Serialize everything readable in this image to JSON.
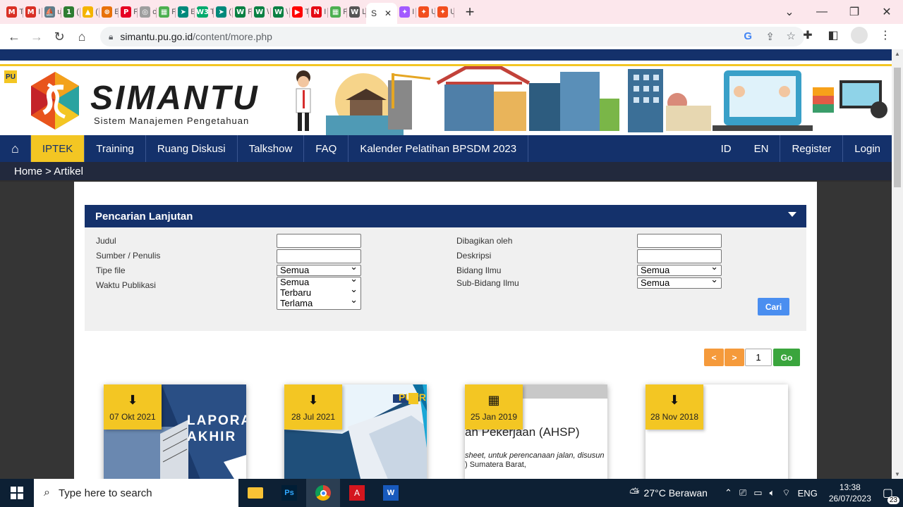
{
  "browser": {
    "tabs": [
      {
        "icon": "gmail-icon",
        "letter": "M",
        "color": "#d93025",
        "label": "T"
      },
      {
        "icon": "gmail-icon",
        "letter": "M",
        "color": "#d93025",
        "label": "I"
      },
      {
        "icon": "site-icon",
        "letter": "⛵",
        "color": "#607d8b",
        "label": "u"
      },
      {
        "icon": "green-circle-icon",
        "letter": "1",
        "color": "#2e7d32",
        "label": "("
      },
      {
        "icon": "drive-icon",
        "letter": "▲",
        "color": "#f4b400",
        "label": "("
      },
      {
        "icon": "orange-circle-icon",
        "letter": "⊛",
        "color": "#e8710a",
        "label": "E"
      },
      {
        "icon": "pinterest-icon",
        "letter": "P",
        "color": "#e60023",
        "label": "F"
      },
      {
        "icon": "fingerprint-icon",
        "letter": "◎",
        "color": "#9e9e9e",
        "label": "c"
      },
      {
        "icon": "colorful-site-icon",
        "letter": "▦",
        "color": "#4caf50",
        "label": "F"
      },
      {
        "icon": "teal-arrow-icon",
        "letter": "➤",
        "color": "#00897b",
        "label": "E"
      },
      {
        "icon": "w3schools-icon",
        "letter": "W3",
        "color": "#04aa6d",
        "label": "T"
      },
      {
        "icon": "teal-arrow-icon",
        "letter": "➤",
        "color": "#00897b",
        "label": "("
      },
      {
        "icon": "w-green-icon",
        "letter": "W",
        "color": "#0b8043",
        "label": "F"
      },
      {
        "icon": "w-green-icon",
        "letter": "W",
        "color": "#0b8043",
        "label": "\\"
      },
      {
        "icon": "w-green-icon",
        "letter": "W",
        "color": "#0b8043",
        "label": "\\"
      },
      {
        "icon": "youtube-icon",
        "letter": "▶",
        "color": "#ff0000",
        "label": "T"
      },
      {
        "icon": "netflix-icon",
        "letter": "N",
        "color": "#e50914",
        "label": "I"
      },
      {
        "icon": "colorful-site-icon",
        "letter": "▦",
        "color": "#4caf50",
        "label": "F"
      },
      {
        "icon": "wikipedia-icon",
        "letter": "W",
        "color": "#555555",
        "label": "L"
      },
      {
        "icon": "figma-icon",
        "letter": "✦",
        "color": "#a259ff",
        "label": "I"
      },
      {
        "icon": "figma-icon",
        "letter": "✦",
        "color": "#f24e1e",
        "label": "U"
      },
      {
        "icon": "figma-icon",
        "letter": "✦",
        "color": "#f24e1e",
        "label": "U"
      }
    ],
    "active_tab": {
      "label": "S",
      "icon": "close-icon"
    },
    "url_host": "simantu.pu.go.id",
    "url_path": "/content/more.php"
  },
  "site": {
    "logo_title": "SIMANTU",
    "logo_subtitle": "Sistem Manajemen Pengetahuan",
    "nav_left": [
      "IPTEK",
      "Training",
      "Ruang Diskusi",
      "Talkshow",
      "FAQ",
      "Kalender Pelatihan BPSDM 2023"
    ],
    "nav_right": [
      "ID",
      "EN",
      "Register",
      "Login"
    ],
    "breadcrumb": "Home > Artikel",
    "colors": {
      "navy": "#14316b",
      "yellow": "#f3c623",
      "orange": "#f59a3b",
      "green": "#3aa53d",
      "blue": "#4a8ef0"
    }
  },
  "search": {
    "title": "Pencarian Lanjutan",
    "labels_left": [
      "Judul",
      "Sumber / Penulis",
      "Tipe file",
      "Waktu Publikasi"
    ],
    "labels_right": [
      "Dibagikan oleh",
      "Deskripsi",
      "Bidang Ilmu",
      "Sub-Bidang Ilmu"
    ],
    "tipe_file": "Semua",
    "waktu_options": [
      "Semua",
      "Terbaru",
      "Terlama"
    ],
    "bidang_ilmu": "Semua",
    "sub_bidang_ilmu": "Semua",
    "submit": "Cari"
  },
  "pager": {
    "prev": "<",
    "next": ">",
    "page": "1",
    "go": "Go"
  },
  "cards": [
    {
      "date": "07 Okt 2021",
      "type_icon": "pdf-icon",
      "cover_text": "LAPORAN AKHIR"
    },
    {
      "date": "28 Jul 2021",
      "type_icon": "pdf-icon",
      "cover_text": "PUPR"
    },
    {
      "date": "25 Jan 2019",
      "type_icon": "film-icon",
      "cover_text": "an Pekerjaan (AHSP)",
      "cover_line2": "sheet, untuk perencanaan jalan, disusun",
      "cover_line3": ") Sumatera Barat,"
    },
    {
      "date": "28 Nov 2018",
      "type_icon": "pdf-icon",
      "cover_text": ""
    }
  ],
  "taskbar": {
    "search_placeholder": "Type here to search",
    "weather": "27°C  Berawan",
    "lang": "ENG",
    "time": "13:38",
    "date": "26/07/2023",
    "notif_count": "23"
  }
}
